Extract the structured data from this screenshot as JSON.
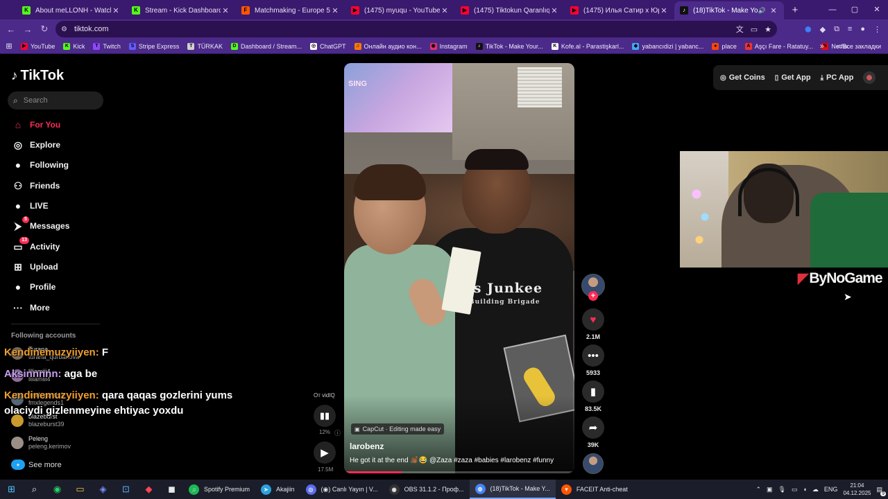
{
  "browser": {
    "tabs": [
      {
        "label": "About meLLONH - Watch Live",
        "favicon": "K",
        "color": "#53fc18",
        "active": false
      },
      {
        "label": "Stream - Kick Dashboard",
        "favicon": "K",
        "color": "#53fc18",
        "active": false
      },
      {
        "label": "Matchmaking - Europe 5v5 Qu",
        "favicon": "F",
        "color": "#ff5500",
        "active": false
      },
      {
        "label": "(1475) myuqu - YouTube",
        "favicon": "▶",
        "color": "#ff0033",
        "active": false
      },
      {
        "label": "(1475) Tiktokun Qaranlıq Üzü",
        "favicon": "▶",
        "color": "#ff0033",
        "active": false
      },
      {
        "label": "(1475) Илья Сатир x Юрий Га",
        "favicon": "▶",
        "color": "#ff0033",
        "active": false
      },
      {
        "label": "(18)TikTok - Make Your Day",
        "favicon": "♪",
        "color": "#111111",
        "active": true
      }
    ],
    "new_tab": "+",
    "window_controls": [
      "—",
      "▢",
      "✕"
    ],
    "url": "tiktok.com",
    "bookmarks": [
      {
        "label": "YouTube",
        "icon": "▶",
        "color": "#ff0033"
      },
      {
        "label": "Kick",
        "icon": "K",
        "color": "#53fc18"
      },
      {
        "label": "Twitch",
        "icon": "T",
        "color": "#9146ff"
      },
      {
        "label": "Stripe Express",
        "icon": "S",
        "color": "#635bff"
      },
      {
        "label": "TÜRKAK",
        "icon": "T",
        "color": "#d0d0d0"
      },
      {
        "label": "Dashboard / Stream...",
        "icon": "D",
        "color": "#53fc18"
      },
      {
        "label": "ChatGPT",
        "icon": "◎",
        "color": "#ffffff"
      },
      {
        "label": "Онлайн аудио кон...",
        "icon": "♫",
        "color": "#ff7a00"
      },
      {
        "label": "Instagram",
        "icon": "◉",
        "color": "#e1306c"
      },
      {
        "label": "TikTok - Make Your...",
        "icon": "♪",
        "color": "#111111"
      },
      {
        "label": "Kofe.al - Parastişkarl...",
        "icon": "K",
        "color": "#ffffff"
      },
      {
        "label": "yabancıdizi | yabanc...",
        "icon": "◆",
        "color": "#3fa9f5"
      },
      {
        "label": "place",
        "icon": "●",
        "color": "#ff4500"
      },
      {
        "label": "Aşçı Fare - Ratatuy...",
        "icon": "A",
        "color": "#e33"
      },
      {
        "label": "Netflix",
        "icon": "N",
        "color": "#e50914"
      }
    ],
    "bookmarks_more": "»",
    "all_bookmarks": "Все закладки"
  },
  "tiktok": {
    "logo": "TikTok",
    "search_placeholder": "Search",
    "nav": [
      {
        "label": "For You",
        "icon": "⌂",
        "active": true,
        "badge": ""
      },
      {
        "label": "Explore",
        "icon": "◎",
        "active": false,
        "badge": ""
      },
      {
        "label": "Following",
        "icon": "●",
        "active": false,
        "badge": ""
      },
      {
        "label": "Friends",
        "icon": "⚇",
        "active": false,
        "badge": ""
      },
      {
        "label": "LIVE",
        "icon": "●",
        "active": false,
        "badge": ""
      },
      {
        "label": "Messages",
        "icon": "⮞",
        "active": false,
        "badge": "5"
      },
      {
        "label": "Activity",
        "icon": "▭",
        "active": false,
        "badge": "13"
      },
      {
        "label": "Upload",
        "icon": "⊞",
        "active": false,
        "badge": ""
      },
      {
        "label": "Profile",
        "icon": "●",
        "active": false,
        "badge": ""
      },
      {
        "label": "More",
        "icon": "···",
        "active": false,
        "badge": ""
      }
    ],
    "following_title": "Following accounts",
    "accounts": [
      {
        "name": "Turana",
        "handle": "turana_qurbanova"
      },
      {
        "name": "liliamiii4",
        "handle": "liliamiii4"
      },
      {
        "name": "fmxlegends1",
        "handle": "fmxlegends1"
      },
      {
        "name": "blazeburst",
        "handle": "blazeburst39"
      },
      {
        "name": "Peleng",
        "handle": "peleng.kerimov"
      }
    ],
    "see_more": "See more",
    "top_buttons": {
      "coins": "Get Coins",
      "app": "Get App",
      "pc": "PC App"
    },
    "video": {
      "tv_text": "SING",
      "shirt_text": "ess Junkee",
      "shirt_sub": "Building Brigade",
      "capcut": "CapCut · Editing made easy",
      "author": "larobenz",
      "description": "He got it at the end 👏🏾😂 @Zaza #zaza #babies #larobenz #funny",
      "progress": 0.25
    },
    "player": {
      "from_label": "От vidIQ",
      "percent": "12%",
      "views": "17.5M"
    },
    "actions": {
      "likes": "2.1M",
      "comments": "5933",
      "saves": "83.5K",
      "shares": "39K"
    }
  },
  "overlay": {
    "chat": [
      {
        "user": "Kendinemuzyiiyen:",
        "msg": " F",
        "user_color": "#f0a030"
      },
      {
        "user": "Aksinnnnn:",
        "msg": " aga be",
        "user_color": "#c8a0f0"
      },
      {
        "user": "Kendinemuzyiiyen:",
        "msg": " qara qaqas gozlerini yums",
        "user_color": "#f0a030"
      },
      {
        "user": "",
        "msg": "olaciydi gizlenmeyine ehtiyac yoxdu",
        "user_color": "#f0a030"
      }
    ],
    "sponsor": "ByNoGame"
  },
  "taskbar": {
    "apps": [
      {
        "label": "Spotify Premium",
        "icon": "♫",
        "color": "#1db954",
        "active": false
      },
      {
        "label": "Akajiin",
        "icon": "➤",
        "color": "#2aa1e0",
        "active": false
      },
      {
        "label": "(◉) Canlı Yayın | V...",
        "icon": "◎",
        "color": "#5b6cf0",
        "active": false
      },
      {
        "label": "OBS 31.1.2 - Проф...",
        "icon": "◉",
        "color": "#333333",
        "active": false
      },
      {
        "label": "(18)TikTok - Make Y...",
        "icon": "◍",
        "color": "#4285f4",
        "active": true
      },
      {
        "label": "FACEIT Anti-cheat",
        "icon": "▼",
        "color": "#ff5500",
        "active": false
      }
    ],
    "lang": "ENG",
    "time": "21:04",
    "date": "04.12.2025",
    "notification_count": "9"
  }
}
